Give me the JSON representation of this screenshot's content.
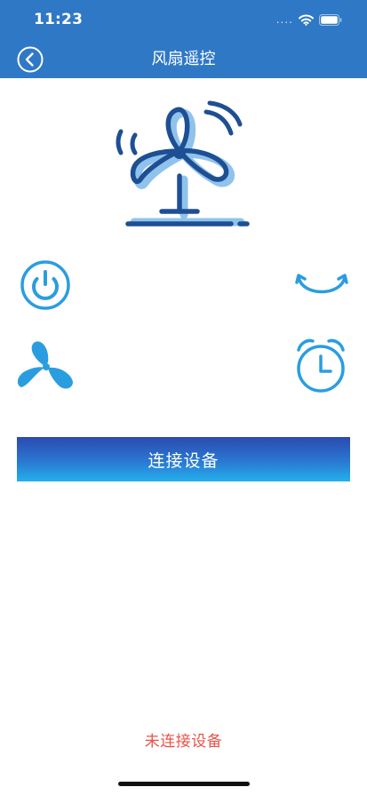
{
  "status_bar": {
    "time": "11:23",
    "signal_dots": "....",
    "icons": [
      "wifi-icon",
      "battery-icon"
    ]
  },
  "header": {
    "title": "风扇遥控",
    "back_icon": "back-circle-icon"
  },
  "hero": {
    "icon": "fan-illustration"
  },
  "controls": {
    "power": "power-icon",
    "swing": "swing-icon",
    "fan_speed": "fan-speed-icon",
    "timer": "timer-alarm-icon"
  },
  "connect_button": {
    "label": "连接设备"
  },
  "connection_status": {
    "text": "未连接设备"
  },
  "colors": {
    "header": "#2f78c6",
    "accent": "#2a9de0",
    "status_text": "#e8524a",
    "button_top": "#2c4ab0",
    "button_bottom": "#24b0ec"
  }
}
